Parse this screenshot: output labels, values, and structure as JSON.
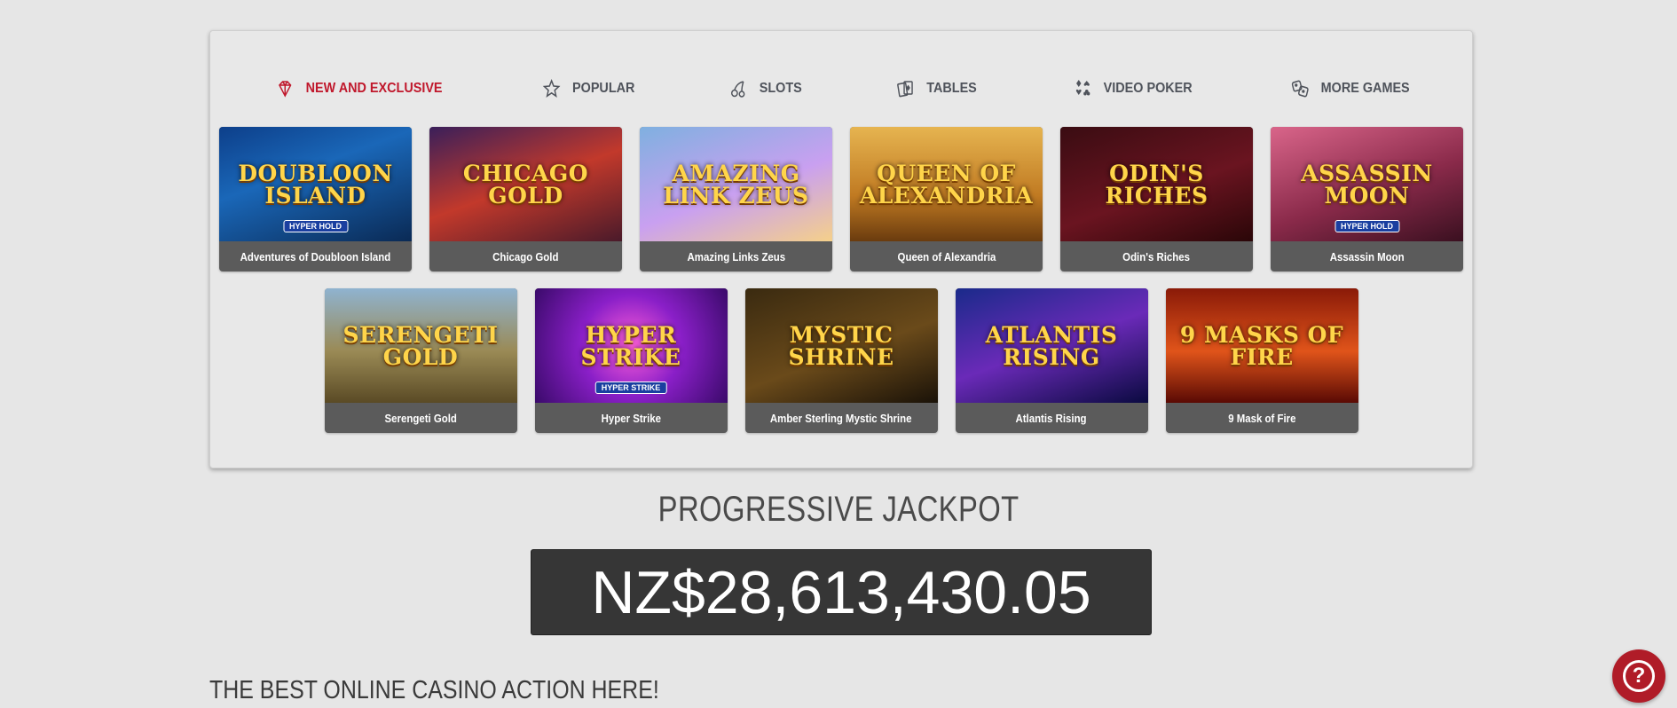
{
  "nav": {
    "tabs": [
      {
        "label": "NEW AND EXCLUSIVE",
        "icon": "diamond-icon",
        "active": true
      },
      {
        "label": "POPULAR",
        "icon": "star-icon",
        "active": false
      },
      {
        "label": "SLOTS",
        "icon": "cherries-icon",
        "active": false
      },
      {
        "label": "TABLES",
        "icon": "cards-icon",
        "active": false
      },
      {
        "label": "VIDEO POKER",
        "icon": "card-suits-icon",
        "active": false
      },
      {
        "label": "MORE GAMES",
        "icon": "dice-icon",
        "active": false
      }
    ]
  },
  "games": [
    {
      "name": "Adventures of Doubloon Island",
      "logo": "Doubloon Island",
      "badge": "HYPER HOLD",
      "bg": "linear-gradient(160deg,#0d3f8a 0%,#1a67b8 40%,#0a2a55 100%)"
    },
    {
      "name": "Chicago Gold",
      "logo": "Chicago Gold",
      "badge": "",
      "bg": "linear-gradient(160deg,#3a1f5a 0%,#c2392b 50%,#4a1a2a 100%)"
    },
    {
      "name": "Amazing Links Zeus",
      "logo": "Amazing Link Zeus",
      "badge": "",
      "bg": "linear-gradient(160deg,#7fb0e0 0%,#c9a0f0 55%,#f5d08a 100%)"
    },
    {
      "name": "Queen of Alexandria",
      "logo": "Queen of Alexandria",
      "badge": "",
      "bg": "linear-gradient(180deg,#e6b450 0%,#c07a22 60%,#6a3b0e 100%)"
    },
    {
      "name": "Odin's Riches",
      "logo": "Odin's Riches",
      "badge": "",
      "bg": "linear-gradient(160deg,#3a0c12 0%,#6a1420 55%,#2a0608 100%)"
    },
    {
      "name": "Assassin Moon",
      "logo": "Assassin Moon",
      "badge": "HYPER HOLD",
      "bg": "linear-gradient(160deg,#d9658a 0%,#8a2a4a 55%,#3a1020 100%)"
    },
    {
      "name": "Serengeti Gold",
      "logo": "Serengeti Gold",
      "badge": "",
      "bg": "linear-gradient(180deg,#8fb3d0 0%,#9a8a55 55%,#5a4a25 100%)"
    },
    {
      "name": "Hyper Strike",
      "logo": "Hyper Strike",
      "badge": "HYPER STRIKE",
      "bg": "radial-gradient(circle at 50% 50%,#ff5fd8 0%,#8a1fc8 45%,#3a0a6a 100%)"
    },
    {
      "name": "Amber Sterling Mystic Shrine",
      "logo": "Mystic Shrine",
      "badge": "",
      "bg": "linear-gradient(160deg,#3a2a10 0%,#6a4a1a 55%,#1a1208 100%)"
    },
    {
      "name": "Atlantis Rising",
      "logo": "Atlantis Rising",
      "badge": "",
      "bg": "linear-gradient(160deg,#1a2a8a 0%,#6a2ab8 50%,#0a0a40 100%)"
    },
    {
      "name": "9 Mask of Fire",
      "logo": "9 Masks of Fire",
      "badge": "",
      "bg": "linear-gradient(180deg,#8a1a08 0%,#e0541a 55%,#5a0a04 100%)"
    }
  ],
  "jackpot": {
    "title": "PROGRESSIVE JACKPOT",
    "amount": "NZ$28,613,430.05"
  },
  "tagline": "THE BEST ONLINE CASINO ACTION HERE!",
  "help": {
    "label": "?",
    "icon": "help-icon",
    "color": "#b01c28"
  },
  "colors": {
    "accent": "#c0182c",
    "caption_bg": "#5b5b5b",
    "jackpot_bg": "#363636",
    "page_bg": "#e6e6e6"
  }
}
